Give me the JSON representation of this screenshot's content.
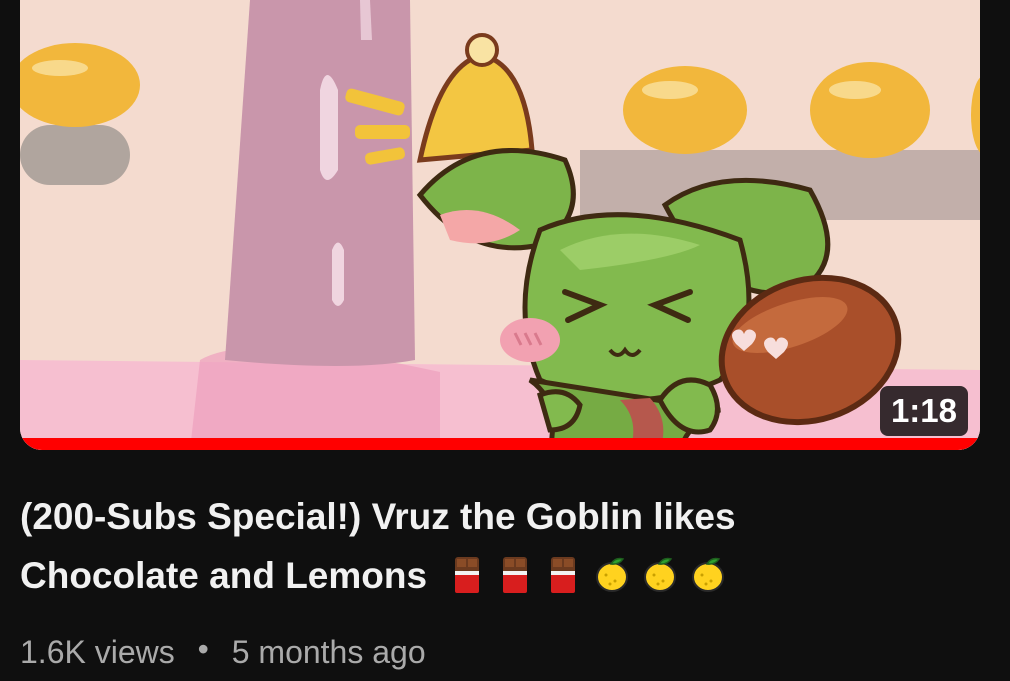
{
  "video": {
    "duration": "1:18",
    "watch_progress": 1.0,
    "progress_color": "#ff0000",
    "title_line1": "(200-Subs Special!) Vruz the Goblin likes",
    "title_line2": "Chocolate and Lemons",
    "title_emojis": [
      "chocolate-bar-icon",
      "chocolate-bar-icon",
      "chocolate-bar-icon",
      "lemon-icon",
      "lemon-icon",
      "lemon-icon"
    ],
    "views": "1.6K views",
    "separator": "•",
    "age": "5 months ago"
  }
}
